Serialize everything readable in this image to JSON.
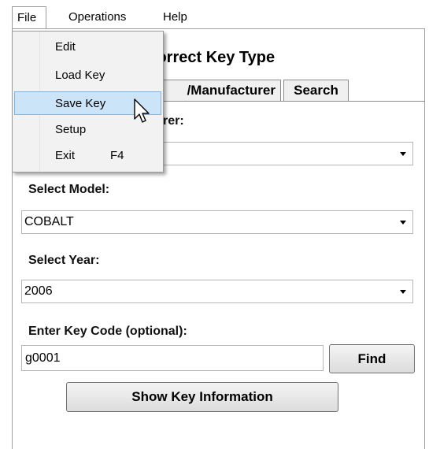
{
  "menubar": {
    "file": "File",
    "operations": "Operations",
    "help": "Help"
  },
  "file_menu": {
    "items": [
      {
        "label": "Edit",
        "shortcut": ""
      },
      {
        "label": "Load Key",
        "shortcut": ""
      },
      {
        "label": "Save Key",
        "shortcut": ""
      },
      {
        "label": "Setup",
        "shortcut": ""
      },
      {
        "label": "Exit",
        "shortcut": "F4"
      }
    ],
    "highlighted": "Save Key"
  },
  "heading": "Correct Key Type",
  "tabs": {
    "manufacturer": "/Manufacturer",
    "search": "Search"
  },
  "form": {
    "manufacturer_label": "rer:",
    "manufacturer_value": "",
    "model_label": "Select Model:",
    "model_value": "COBALT",
    "year_label": "Select Year:",
    "year_value": "2006",
    "keycode_label": "Enter Key Code (optional):",
    "keycode_value": "g0001",
    "find_label": "Find",
    "show_key_label": "Show Key Information"
  },
  "icons": {
    "dropdown_arrow": "chevron-down-icon",
    "cursor": "mouse-pointer-icon"
  },
  "colors": {
    "menu_highlight": "#cce4f7",
    "menu_highlight_border": "#7fb5e2",
    "menu_background": "#f2f2f2"
  }
}
